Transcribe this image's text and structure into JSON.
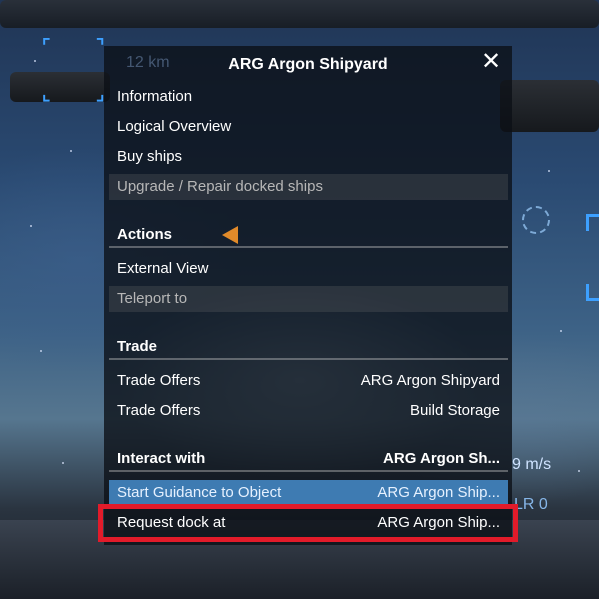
{
  "window": {
    "title": "ARG Argon Shipyard",
    "bg_distance": "12 km",
    "close_glyph": "✕"
  },
  "menu": {
    "items": [
      {
        "label": "Information"
      },
      {
        "label": "Logical Overview"
      },
      {
        "label": "Buy ships"
      },
      {
        "label": "Upgrade / Repair docked ships",
        "disabled": true
      }
    ],
    "actions_header": "Actions",
    "actions": [
      {
        "label": "External View"
      },
      {
        "label": "Teleport to",
        "disabled": true
      }
    ],
    "trade_header": "Trade",
    "trade": [
      {
        "label": "Trade Offers",
        "value": "ARG Argon Shipyard"
      },
      {
        "label": "Trade Offers",
        "value": "Build Storage"
      }
    ],
    "interact_header": "Interact with",
    "interact_target": "ARG Argon Sh...",
    "interact": [
      {
        "label": "Start Guidance to Object",
        "value": "ARG Argon Ship..."
      },
      {
        "label": "Request dock at",
        "value": "ARG Argon Ship..."
      }
    ]
  },
  "hud": {
    "speed": "9 m/s",
    "mode": "LR 0"
  },
  "colors": {
    "highlight": "#3e7bb2",
    "selection_outline": "#e21b2a",
    "hud_blue": "#3da0ff",
    "marker": "#e08a2a"
  }
}
